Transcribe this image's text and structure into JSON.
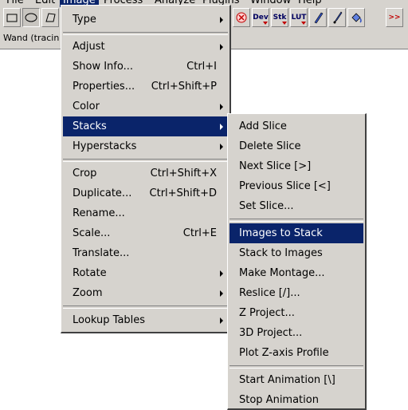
{
  "menubar": {
    "items": [
      {
        "label": "File"
      },
      {
        "label": "Edit"
      },
      {
        "label": "Image"
      },
      {
        "label": "Process"
      },
      {
        "label": "Analyze"
      },
      {
        "label": "Plugins"
      },
      {
        "label": "Window"
      },
      {
        "label": "Help"
      }
    ]
  },
  "toolbar": {
    "tools": [
      {
        "icon": "rectangle-tool-icon"
      },
      {
        "icon": "oval-tool-icon"
      },
      {
        "icon": "polygon-tool-icon"
      },
      {
        "icon": "close-red-icon",
        "color": "#c00000"
      },
      {
        "icon": "dev-tool-icon",
        "label": "Dev"
      },
      {
        "icon": "stk-tool-icon",
        "label": "Stk"
      },
      {
        "icon": "lut-tool-icon",
        "label": "LUT"
      },
      {
        "icon": "pencil-icon"
      },
      {
        "icon": "paintbrush-icon"
      },
      {
        "icon": "flood-fill-icon"
      },
      {
        "icon": "more-tools-icon",
        "label": ">>",
        "color": "#c00000"
      }
    ]
  },
  "status": {
    "text": "Wand (tracin"
  },
  "image_menu": {
    "items": [
      {
        "label": "Type",
        "submenu": true
      },
      {
        "label": "Adjust",
        "submenu": true
      },
      {
        "label": "Show Info...",
        "shortcut": "Ctrl+I"
      },
      {
        "label": "Properties...",
        "shortcut": "Ctrl+Shift+P"
      },
      {
        "label": "Color",
        "submenu": true
      },
      {
        "label": "Stacks",
        "submenu": true,
        "highlighted": true
      },
      {
        "label": "Hyperstacks",
        "submenu": true
      },
      {
        "label": "Crop",
        "shortcut": "Ctrl+Shift+X"
      },
      {
        "label": "Duplicate...",
        "shortcut": "Ctrl+Shift+D"
      },
      {
        "label": "Rename..."
      },
      {
        "label": "Scale...",
        "shortcut": "Ctrl+E"
      },
      {
        "label": "Translate..."
      },
      {
        "label": "Rotate",
        "submenu": true
      },
      {
        "label": "Zoom",
        "submenu": true
      },
      {
        "label": "Lookup Tables",
        "submenu": true
      }
    ]
  },
  "stacks_menu": {
    "items": [
      {
        "label": "Add Slice"
      },
      {
        "label": "Delete Slice"
      },
      {
        "label": "Next Slice [>]"
      },
      {
        "label": "Previous Slice [<]"
      },
      {
        "label": "Set Slice..."
      },
      {
        "label": "Images to Stack",
        "highlighted": true
      },
      {
        "label": "Stack to Images"
      },
      {
        "label": "Make Montage..."
      },
      {
        "label": "Reslice [/]..."
      },
      {
        "label": "Z Project..."
      },
      {
        "label": "3D Project..."
      },
      {
        "label": "Plot Z-axis Profile"
      },
      {
        "label": "Start Animation [\\]"
      },
      {
        "label": "Stop Animation"
      }
    ]
  },
  "colors": {
    "highlight": "#0a246a",
    "menu_bg": "#d6d3ce",
    "accent_red": "#c00000"
  }
}
